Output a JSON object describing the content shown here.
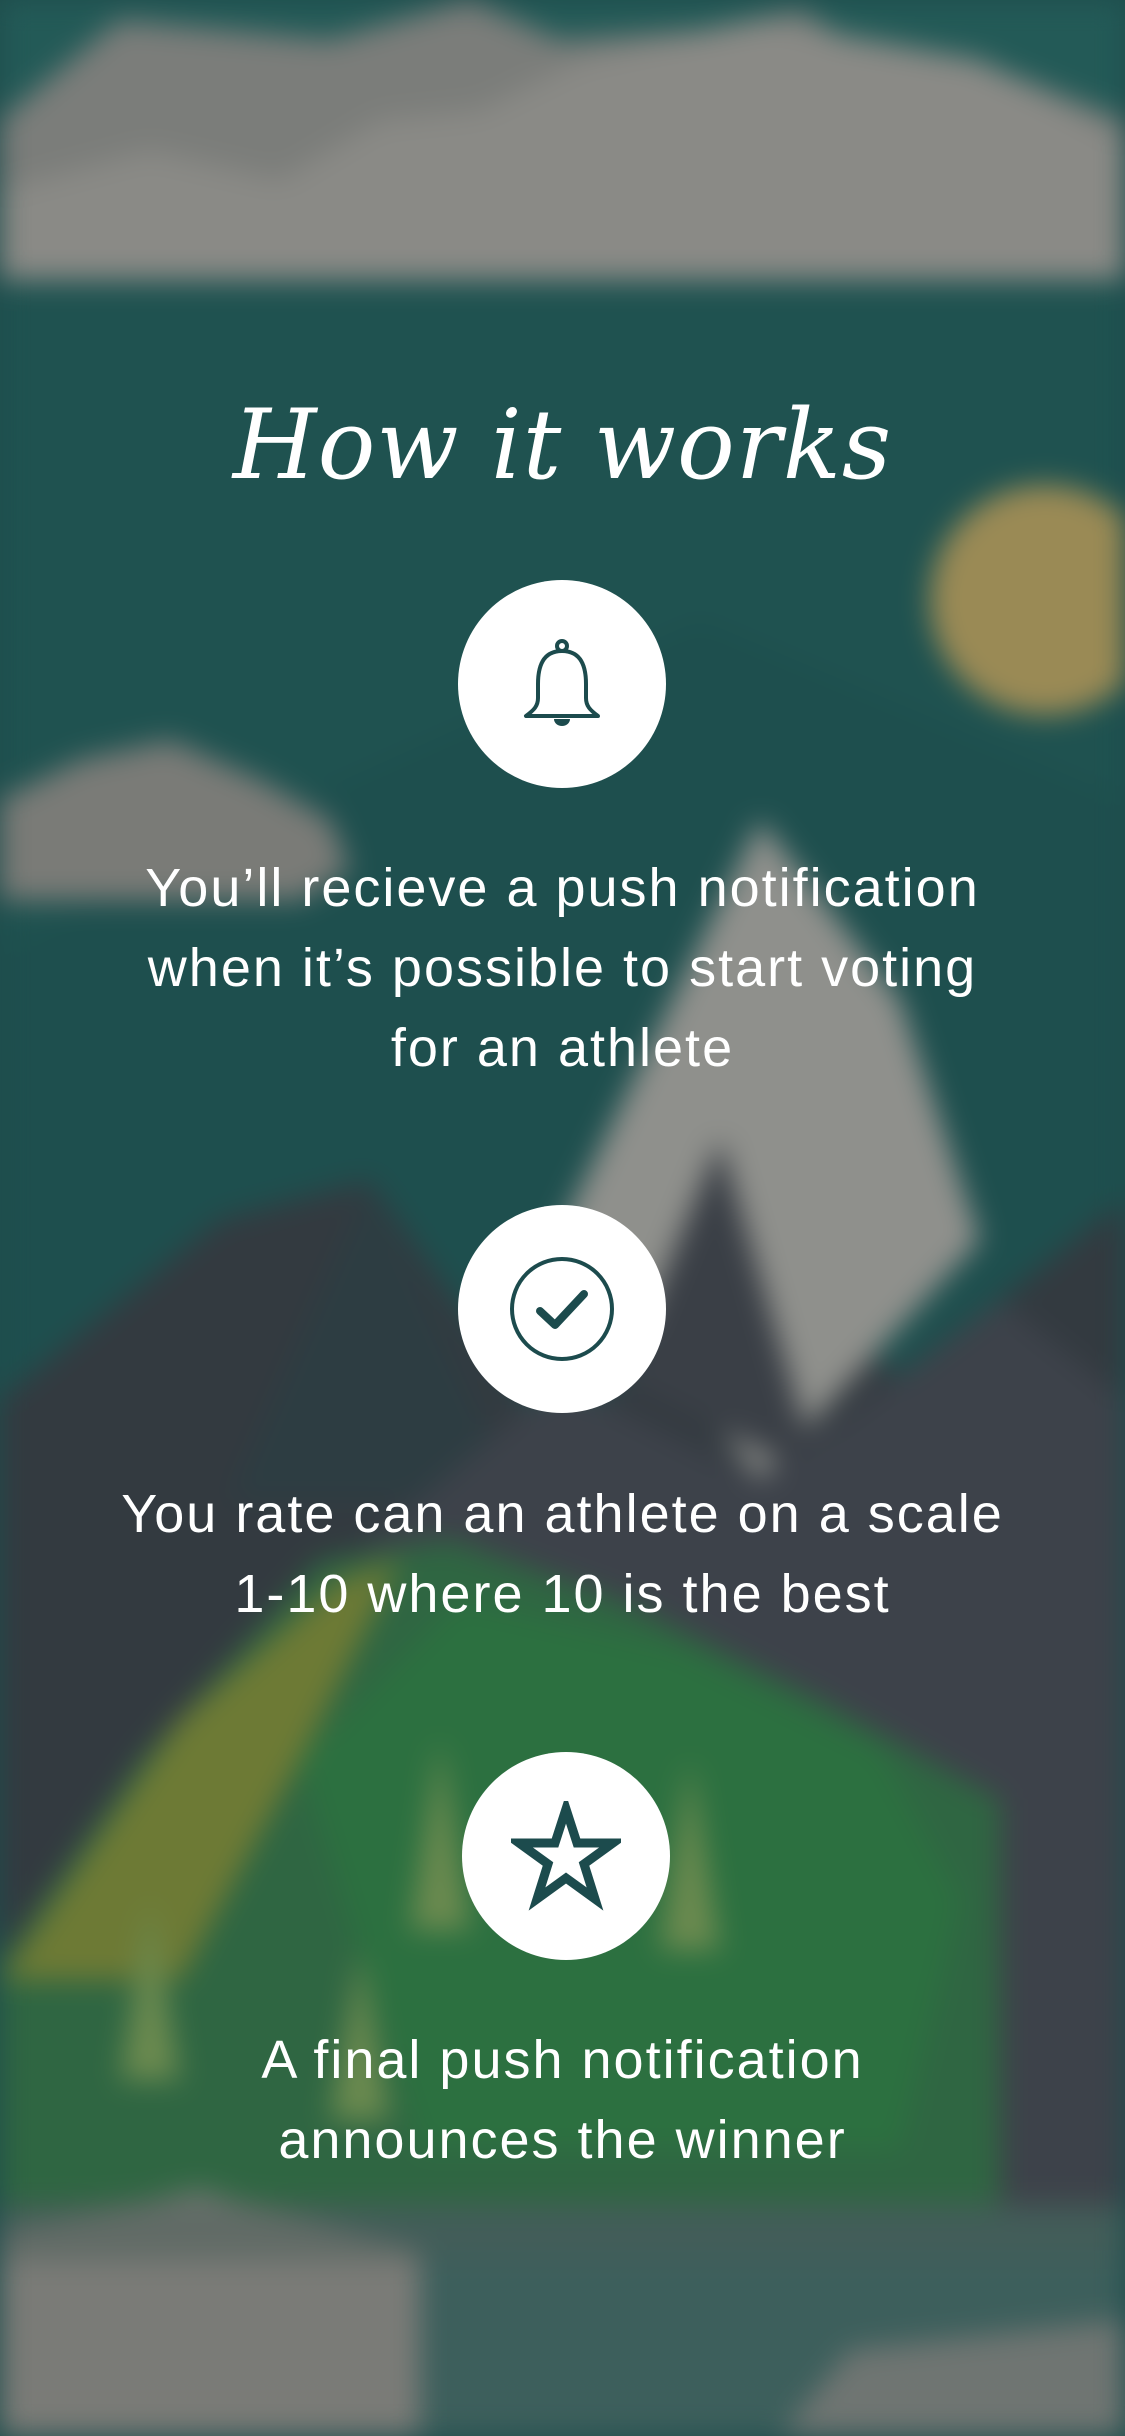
{
  "page": {
    "title": "How it works"
  },
  "steps": [
    {
      "icon": "bell-icon",
      "text": "You’ll recieve a push notification\nwhen it’s possible to start voting\nfor an athlete"
    },
    {
      "icon": "check-circle-icon",
      "text": "You rate can an athlete on a scale\n1-10 where 10 is the best"
    },
    {
      "icon": "star-icon",
      "text": "A final push notification\nannounces the winner"
    }
  ],
  "colors": {
    "icon": "#1c4b4d",
    "text": "#ffffff",
    "background": "#1f4d4c"
  }
}
